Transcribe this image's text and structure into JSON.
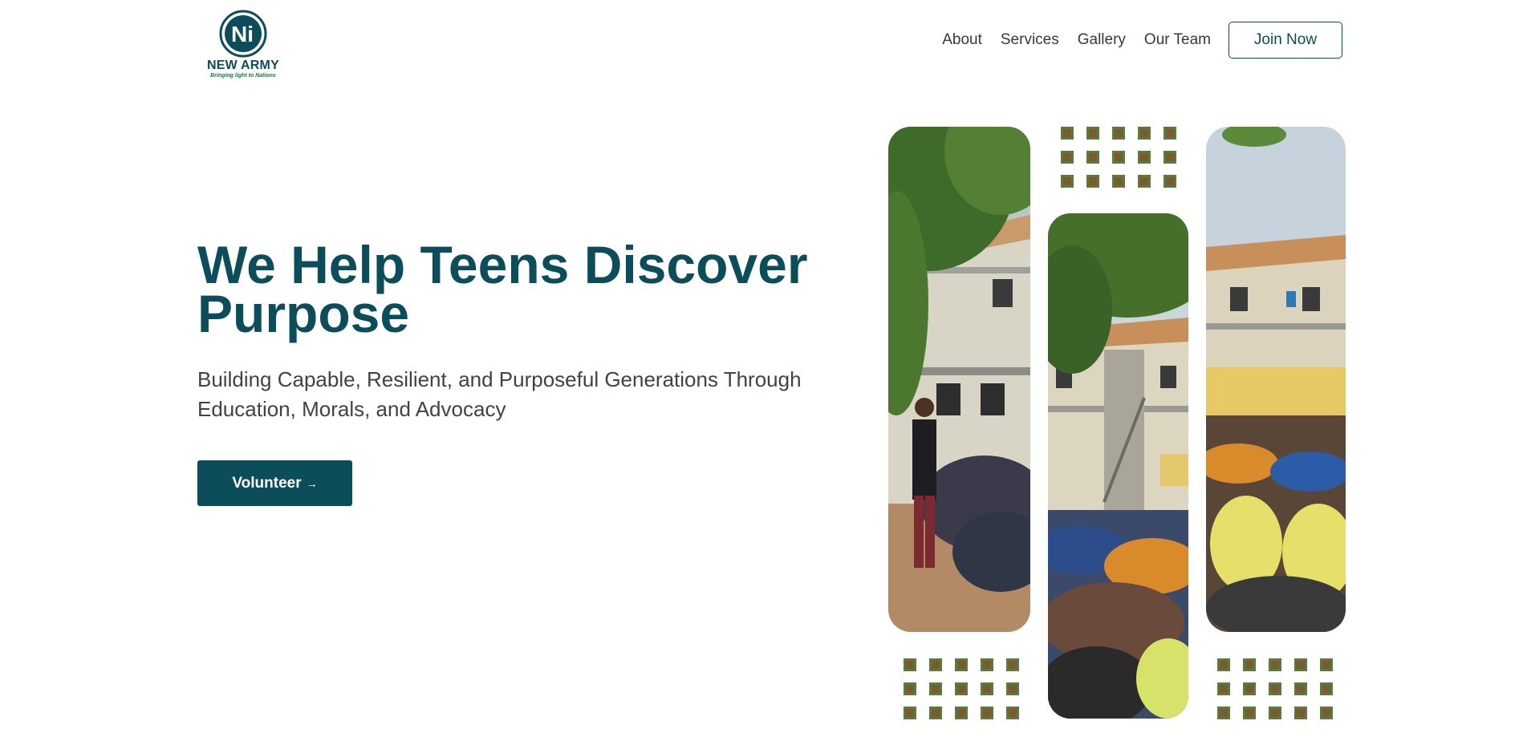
{
  "brand": {
    "name": "NEW ARMY",
    "tagline": "Bringing light to Nations",
    "mark_letter": "Ni",
    "primary_color": "#0b4d5a",
    "accent_color": "#1a7a3a"
  },
  "nav": {
    "items": [
      {
        "label": "About"
      },
      {
        "label": "Services"
      },
      {
        "label": "Gallery"
      },
      {
        "label": "Our Team"
      }
    ],
    "cta_label": "Join Now"
  },
  "hero": {
    "title": "We Help Teens Discover Purpose",
    "subtitle": "Building Capable, Resilient, and Purposeful Generations Through Education, Morals, and Advocacy",
    "button_label": "Volunteer",
    "button_icon": "arrow-right-icon",
    "button_arrow": "→"
  },
  "gallery": {
    "photos": [
      {
        "name": "speaker-addressing-students-photo"
      },
      {
        "name": "students-assembly-building-photo"
      },
      {
        "name": "students-seated-crowd-photo"
      }
    ]
  }
}
